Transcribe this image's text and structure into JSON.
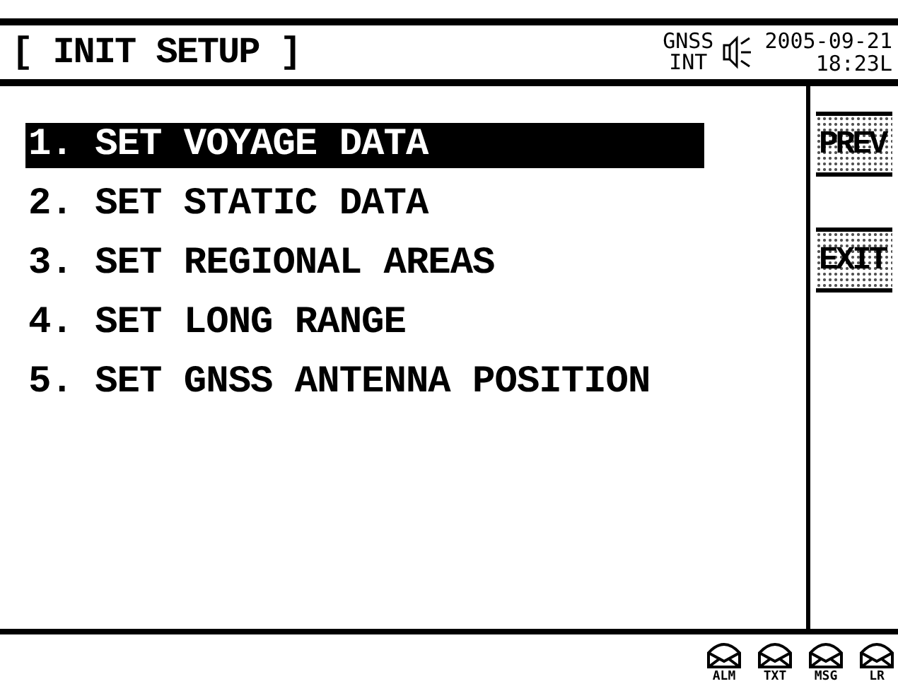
{
  "header": {
    "title": "[ INIT SETUP ]",
    "gnss_source": [
      "GNSS",
      "INT"
    ],
    "date": "2005-09-21",
    "time": "18:23L"
  },
  "menu": [
    {
      "label": "1. SET VOYAGE DATA",
      "selected": true
    },
    {
      "label": "2. SET STATIC DATA",
      "selected": false
    },
    {
      "label": "3. SET REGIONAL AREAS",
      "selected": false
    },
    {
      "label": "4. SET LONG RANGE",
      "selected": false
    },
    {
      "label": "5. SET GNSS ANTENNA POSITION",
      "selected": false
    }
  ],
  "buttons": [
    "PREV",
    "EXIT"
  ],
  "status_icons": [
    "ALM",
    "TXT",
    "MSG",
    "LR"
  ]
}
